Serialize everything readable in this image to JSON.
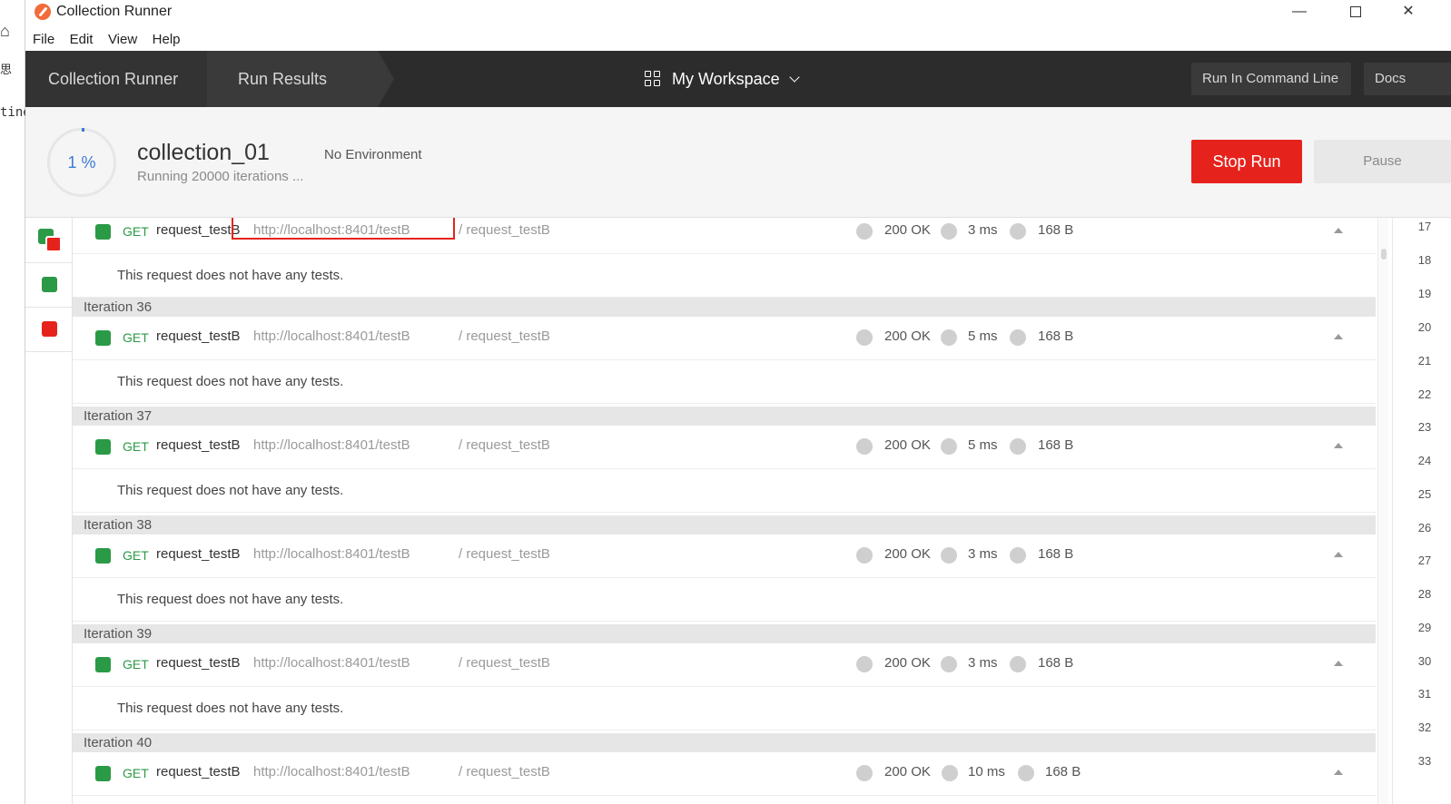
{
  "background_app": {
    "home_glyph": "⌂",
    "cjk_text": "思",
    "code_text": "tine"
  },
  "window": {
    "title": "Collection Runner",
    "controls": {
      "minimize": "—",
      "close": "✕"
    }
  },
  "menu": [
    "File",
    "Edit",
    "View",
    "Help"
  ],
  "header": {
    "tabs": [
      "Collection Runner",
      "Run Results"
    ],
    "workspace": "My Workspace",
    "buttons": {
      "command_line": "Run In Command Line",
      "docs": "Docs"
    }
  },
  "summary": {
    "progress_pct": "1 %",
    "collection_name": "collection_01",
    "iterations_text": "Running 20000 iterations ...",
    "environment": "No Environment",
    "stop_label": "Stop Run",
    "pause_label": "Pause"
  },
  "results": {
    "no_tests_text": "This request does not have any tests.",
    "first_request": {
      "method": "GET",
      "name": "request_testB",
      "url": "http://localhost:8401/testB",
      "path": "/ request_testB",
      "status": "200 OK",
      "time": "3 ms",
      "size": "168 B"
    },
    "iterations": [
      {
        "label": "Iteration 36",
        "method": "GET",
        "name": "request_testB",
        "url": "http://localhost:8401/testB",
        "path": "/ request_testB",
        "status": "200 OK",
        "time": "5 ms",
        "size": "168 B"
      },
      {
        "label": "Iteration 37",
        "method": "GET",
        "name": "request_testB",
        "url": "http://localhost:8401/testB",
        "path": "/ request_testB",
        "status": "200 OK",
        "time": "5 ms",
        "size": "168 B"
      },
      {
        "label": "Iteration 38",
        "method": "GET",
        "name": "request_testB",
        "url": "http://localhost:8401/testB",
        "path": "/ request_testB",
        "status": "200 OK",
        "time": "3 ms",
        "size": "168 B"
      },
      {
        "label": "Iteration 39",
        "method": "GET",
        "name": "request_testB",
        "url": "http://localhost:8401/testB",
        "path": "/ request_testB",
        "status": "200 OK",
        "time": "3 ms",
        "size": "168 B"
      },
      {
        "label": "Iteration 40",
        "method": "GET",
        "name": "request_testB",
        "url": "http://localhost:8401/testB",
        "path": "/ request_testB",
        "status": "200 OK",
        "time": "10 ms",
        "size": "168 B"
      }
    ]
  },
  "line_numbers": [
    "17",
    "18",
    "19",
    "20",
    "21",
    "22",
    "23",
    "24",
    "25",
    "26",
    "27",
    "28",
    "29",
    "30",
    "31",
    "32",
    "33"
  ],
  "colors": {
    "pass": "#2b9a46",
    "fail": "#e5231c",
    "header_bg": "#2c2c2c",
    "progress": "#3c7ad6"
  }
}
